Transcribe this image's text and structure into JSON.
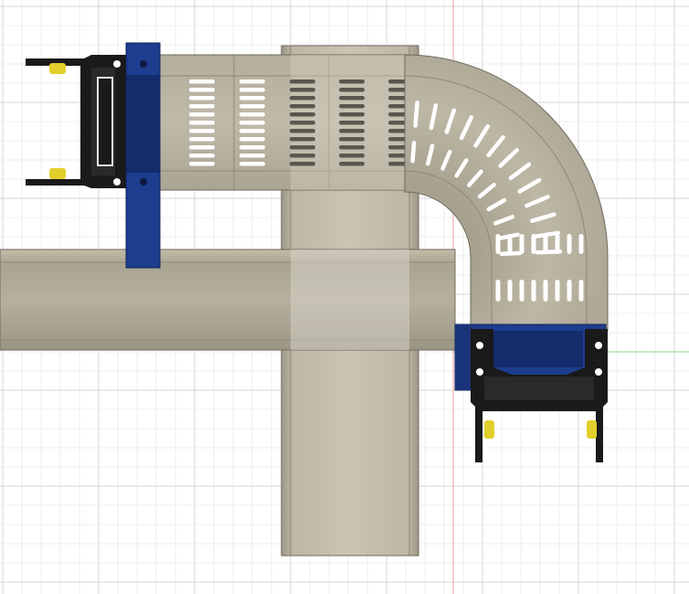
{
  "viewport": {
    "background": "#ffffff",
    "grid_minor_color": "#ececec",
    "grid_major_color": "#d4d4d4",
    "axis_x_color": "#8fd48f",
    "axis_y_color": "#e8a0a0"
  },
  "model": {
    "metal_color": "#b9b3a1",
    "metal_dark": "#8d887a",
    "metal_light": "#d2cdbf",
    "bracket_color": "#1a1a1a",
    "clamp_color": "#1d3d8f",
    "clamp_shade": "#142c6b",
    "pin_color": "#e3cf2b",
    "slot_color": "#ffffff"
  }
}
